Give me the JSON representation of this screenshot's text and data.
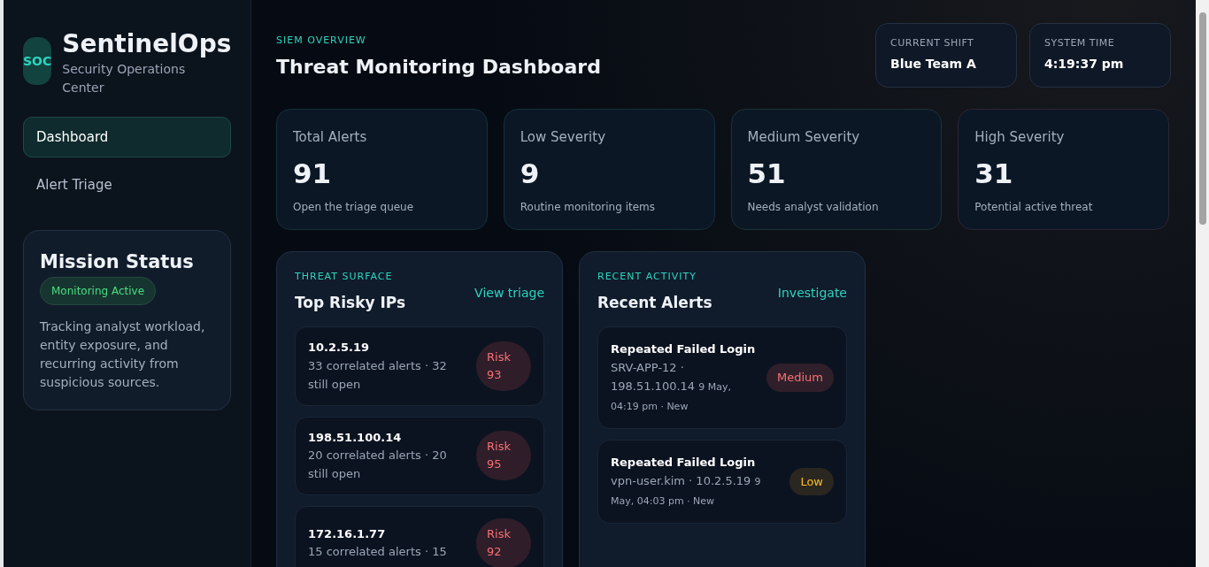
{
  "brand": {
    "logo": "SOC",
    "name": "SentinelOps",
    "subtitle": "Security Operations Center"
  },
  "nav": [
    {
      "label": "Dashboard",
      "selected": true
    },
    {
      "label": "Alert Triage",
      "selected": false
    }
  ],
  "mission": {
    "title": "Mission Status",
    "badge": "Monitoring Active",
    "text": "Tracking analyst workload, entity exposure, and recurring activity from suspicious sources."
  },
  "header": {
    "eyebrow": "SIEM OVERVIEW",
    "title": "Threat Monitoring Dashboard"
  },
  "info_cards": [
    {
      "label": "CURRENT SHIFT",
      "value": "Blue Team A"
    },
    {
      "label": "SYSTEM TIME",
      "value": "4:19:37 pm"
    }
  ],
  "stats": [
    {
      "label": "Total Alerts",
      "value": "91",
      "note": "Open the triage queue",
      "color": "#123039"
    },
    {
      "label": "Low Severity",
      "value": "9",
      "note": "Routine monitoring items",
      "color": "#123039"
    },
    {
      "label": "Medium Severity",
      "value": "51",
      "note": "Needs analyst validation",
      "color": "#1d3333"
    },
    {
      "label": "High Severity",
      "value": "31",
      "note": "Potential active threat",
      "color": "#2f2333"
    }
  ],
  "risky_ips": {
    "eyebrow": "THREAT SURFACE",
    "title": "Top Risky IPs",
    "link": "View triage",
    "items": [
      {
        "ip": "10.2.5.19",
        "detail": "33 correlated alerts · 32 still open",
        "risk": "Risk 93"
      },
      {
        "ip": "198.51.100.14",
        "detail": "20 correlated alerts · 20 still open",
        "risk": "Risk 95"
      },
      {
        "ip": "172.16.1.77",
        "detail": "15 correlated alerts · 15",
        "risk": "Risk 92"
      }
    ]
  },
  "recent_alerts": {
    "eyebrow": "RECENT ACTIVITY",
    "title": "Recent Alerts",
    "link": "Investigate",
    "items": [
      {
        "title": "Repeated Failed Login",
        "source": "SRV-APP-12 · 198.51.100.14",
        "meta": "9 May, 04:19 pm · New",
        "severity": "Medium",
        "kind": "medium"
      },
      {
        "title": "Repeated Failed Login",
        "source": "vpn-user.kim · 10.2.5.19",
        "meta": "9 May, 04:03 pm · New",
        "severity": "Low",
        "kind": "low"
      }
    ]
  }
}
